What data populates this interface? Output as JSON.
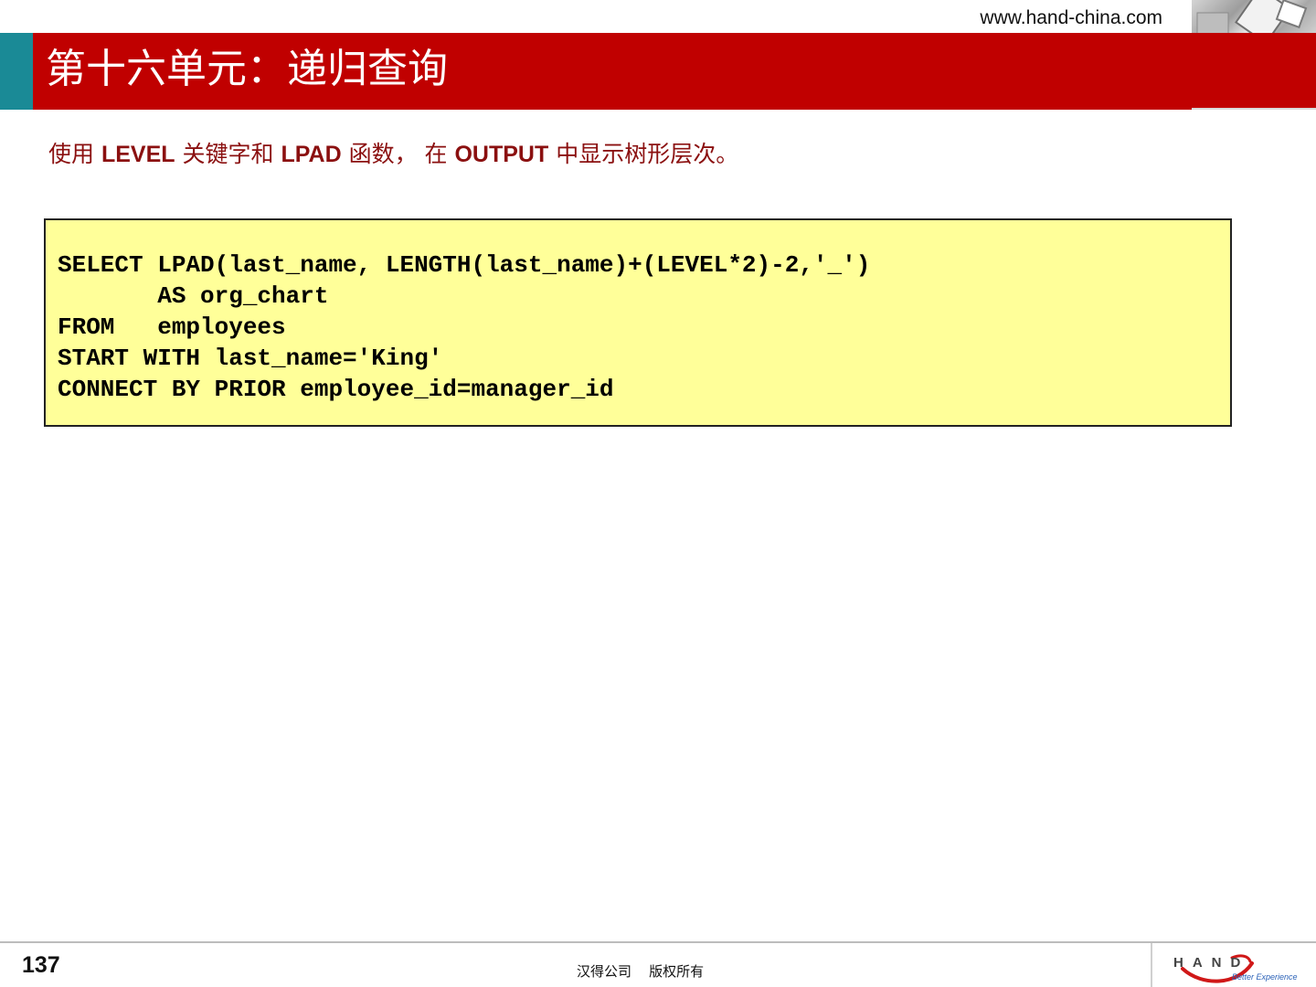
{
  "header": {
    "site_url": "www.hand-china.com",
    "title": "第十六单元：递归查询"
  },
  "subtitle": {
    "parts": [
      "使用 ",
      "LEVEL",
      " 关键字和 ",
      "LPAD",
      " 函数， 在 ",
      "OUTPUT",
      " 中显示树形层次。"
    ]
  },
  "code_block": {
    "lines": [
      "SELECT LPAD(last_name, LENGTH(last_name)+(LEVEL*2)-2,'_')",
      "       AS org_chart",
      "FROM   employees",
      "START WITH last_name='King'",
      "CONNECT BY PRIOR employee_id=manager_id"
    ]
  },
  "footer": {
    "page_number": "137",
    "copyright": "汉得公司    版权所有",
    "logo_text": "HAND",
    "logo_tagline": "Better Experience"
  },
  "colors": {
    "title_bar": "#c00000",
    "title_accent": "#1a8a96",
    "subtitle_text": "#8b1010",
    "code_background": "#ffff99"
  },
  "icons": {
    "corner_photo": "corner-photo-graphic",
    "logo": "hand-logo"
  }
}
